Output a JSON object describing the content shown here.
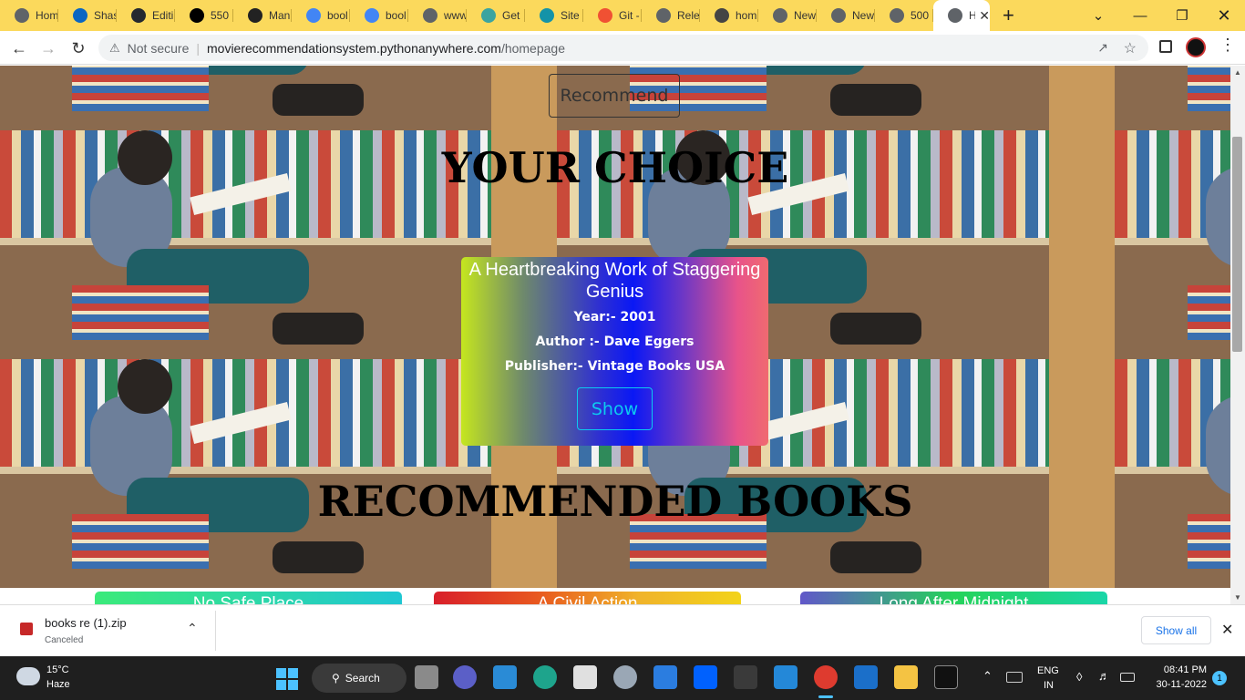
{
  "browser": {
    "tabs": [
      {
        "label": "Hom",
        "icon": "globe-icon",
        "color": "#5f6368"
      },
      {
        "label": "Shas",
        "icon": "linkedin-icon",
        "color": "#0a66c2"
      },
      {
        "label": "Editi",
        "icon": "github-icon",
        "color": "#24292f"
      },
      {
        "label": "550",
        "icon": "imdb-like-icon",
        "color": "#000000"
      },
      {
        "label": "Man",
        "icon": "is-icon",
        "color": "#222222"
      },
      {
        "label": "bool",
        "icon": "google-icon",
        "color": "#4285f4"
      },
      {
        "label": "bool",
        "icon": "google-icon",
        "color": "#4285f4"
      },
      {
        "label": "www",
        "icon": "globe-icon",
        "color": "#5f6368"
      },
      {
        "label": "Get",
        "icon": "edit-icon",
        "color": "#3ba4a0"
      },
      {
        "label": "Site",
        "icon": "diamond-icon",
        "color": "#1493a8"
      },
      {
        "label": "Git -",
        "icon": "git-icon",
        "color": "#f05133"
      },
      {
        "label": "Rele",
        "icon": "globe-icon",
        "color": "#5f6368"
      },
      {
        "label": "hom",
        "icon": "swirl-icon",
        "color": "#444444"
      },
      {
        "label": "New",
        "icon": "chrome-icon",
        "color": "#5f6368"
      },
      {
        "label": "New",
        "icon": "chrome-icon",
        "color": "#5f6368"
      },
      {
        "label": "500",
        "icon": "globe-icon",
        "color": "#5f6368"
      },
      {
        "label": "H",
        "icon": "globe-icon",
        "color": "#5f6368",
        "active": true
      }
    ],
    "omnibox": {
      "security": "Not secure",
      "host": "movierecommendationsystem.pythonanywhere.com",
      "path": "/homepage"
    }
  },
  "page": {
    "recommend_button": "Recommend",
    "your_choice_heading": "YOUR CHOICE",
    "selected_book": {
      "title": "A Heartbreaking Work of Staggering Genius",
      "year": "Year:- 2001",
      "author": "Author :- Dave Eggers",
      "publisher": "Publisher:- Vintage Books USA",
      "show_button": "Show"
    },
    "recommended_heading": "RECOMMENDED BOOKS",
    "recommended": [
      {
        "title": "No Safe Place"
      },
      {
        "title": "A Civil Action"
      },
      {
        "title": "Long After Midnight"
      }
    ]
  },
  "download": {
    "filename": "books re (1).zip",
    "status": "Canceled",
    "show_all": "Show all"
  },
  "taskbar": {
    "temperature": "15°C",
    "weather": "Haze",
    "search": "Search",
    "lang1": "ENG",
    "lang2": "IN",
    "time": "08:41 PM",
    "date": "30-11-2022",
    "notification_count": "1"
  },
  "colors": {
    "tabbar": "#fbd95c",
    "show_button": "#0dcaf0",
    "taskbar": "#1f1f1f"
  }
}
